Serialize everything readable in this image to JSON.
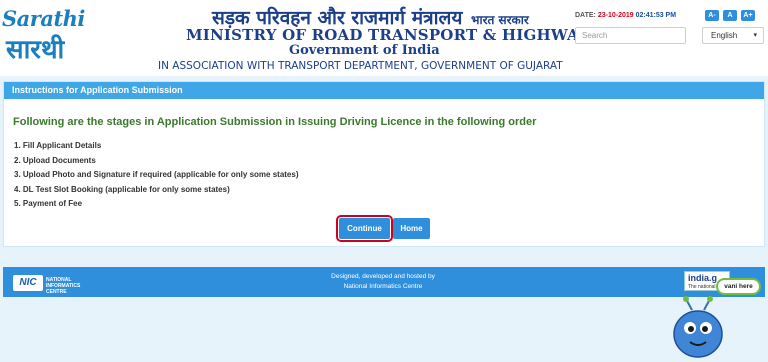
{
  "header": {
    "logo_latin": "Sarathi",
    "logo_devanagari": "सारथी",
    "hindi_title": "सड़क परिवहन और राजमार्ग मंत्रालय",
    "hindi_suffix": "भारत सरकार",
    "ministry": "MINISTRY OF ROAD TRANSPORT & HIGHWAYS",
    "government": "Government of India",
    "association": "IN ASSOCIATION WITH TRANSPORT DEPARTMENT, GOVERNMENT OF GUJARAT",
    "date_label": "DATE:",
    "date_value": "23-10-2019",
    "time_value": "02:41:53 PM",
    "font_buttons": [
      "A-",
      "A",
      "A+"
    ],
    "search_placeholder": "Search",
    "language": "English"
  },
  "panel": {
    "title": "Instructions for Application Submission",
    "heading": "Following are the stages in Application Submission in Issuing Driving Licence in the following order",
    "steps": [
      "1. Fill Applicant Details",
      "2. Upload Documents",
      "3. Upload Photo and Signature if required (applicable for only some states)",
      "4. DL Test Slot Booking (applicable for only some states)",
      "5. Payment of Fee"
    ],
    "continue_label": "Continue",
    "home_label": "Home"
  },
  "footer": {
    "nic_mark": "NIC",
    "nic_name": "NATIONAL INFORMATICS CENTRE",
    "line1": "Designed, developed and hosted by",
    "line2": "National Informatics Centre"
  },
  "widgets": {
    "indiagov_title": "india.g",
    "indiagov_sub": "The national",
    "chat_bubble": "vani here"
  },
  "colors": {
    "primary": "#2f8fdc",
    "panel_header": "#3fa7e8",
    "heading_green": "#3a7a2c",
    "title_navy": "#1d3f8a",
    "highlight_red": "#d0021b"
  }
}
